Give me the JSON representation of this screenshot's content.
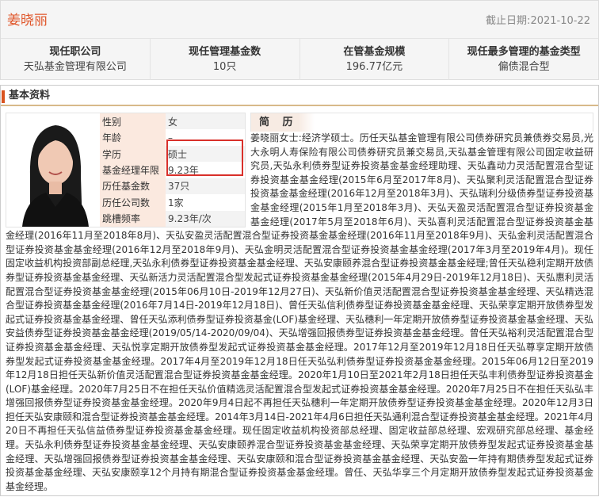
{
  "header": {
    "name": "姜晓丽",
    "date_label": "截止日期:",
    "date": "2021-10-22"
  },
  "stats": [
    {
      "label": "现任职公司",
      "value": "天弘基金管理有限公司"
    },
    {
      "label": "现任管理基金数",
      "value": "10只"
    },
    {
      "label": "在管基金规模",
      "value": "196.77亿元"
    },
    {
      "label": "现任最多管理的基金类型",
      "value": "偏债混合型"
    }
  ],
  "section": {
    "title": "基本资料"
  },
  "profile": [
    {
      "k": "性别",
      "v": "女"
    },
    {
      "k": "年龄",
      "v": "–"
    },
    {
      "k": "学历",
      "v": "硕士"
    },
    {
      "k": "基金经理年限",
      "v": "9.23年"
    },
    {
      "k": "历任基金数",
      "v": "37只"
    },
    {
      "k": "历任公司数",
      "v": "1家"
    },
    {
      "k": "跳槽频率",
      "v": "9.23年/次"
    }
  ],
  "bio": {
    "title": "简 历",
    "text": "姜晓丽女士:经济学硕士。历任天弘基金管理有限公司债券研究员兼债券交易员,光大永明人寿保险有限公司债券研究员兼交易员,天弘基金管理有限公司固定收益研究员,天弘永利债券型证券投资基金基金经理助理、天弘鑫动力灵活配置混合型证券投资基金基金经理(2015年6月至2017年8月)、天弘聚利灵活配置混合型证券投资基金基金经理(2016年12月至2018年3月)、天弘瑞利分级债券型证券投资基金基金经理(2015年1月至2018年3月)、天弘天盈灵活配置混合型证券投资基金基金经理(2017年5月至2018年6月)、天弘喜利灵活配置混合型证券投资基金基金经理(2016年11月至2018年8月)、天弘安盈灵活配置混合型证券投资基金基金经理(2016年11月至2018年9月)、天弘金利灵活配置混合型证券投资基金基金经理(2016年12月至2018年9月)、天弘金明灵活配置混合型证券投资基金基金经理(2017年3月至2019年4月)。现任固定收益机构投资部副总经理,天弘永利债券型证券投资基金基金经理、天弘安康颐养混合型证券投资基金基金经理;曾任天弘稳利定期开放债券型证券投资基金基金经理、天弘新活力灵活配置混合型发起式证券投资基金基金经理(2015年4月29日-2019年12月18日)、天弘惠利灵活配置混合型证券投资基金基金经理(2015年06月10日-2019年12月27日)、天弘新价值灵活配置混合型证券投资基金基金经理、天弘精选混合型证券投资基金基金经理(2016年7月14日-2019年12月18日)、曾任天弘信利债券型证券投资基金基金经理、天弘荣享定期开放债券型发起式证券投资基金基金经理、曾任天弘添利债券型证券投资基金(LOF)基金经理、天弘穗利一年定期开放债券型证券投资基金基金经理、天弘安益债券型证券投资基金基金经理(2019/05/14-2020/09/04)、天弘增强回报债券型证券投资基金基金经理。曾任天弘裕利灵活配置混合型证券投资基金基金经理、天弘悦享定期开放债券型发起式证券投资基金基金经理。2017年12月至2019年12月18日任天弘尊享定期开放债券型发起式证券投资基金基金经理。2017年4月至2019年12月18日任天弘弘利债券型证券投资基金基金经理。2015年06月12日至2019年12月18日担任天弘新价值灵活配置混合型证券投资基金基金经理。2020年1月10日至2021年2月18日担任天弘丰利债券型证券投资基金(LOF)基金经理。2020年7月25日不在担任天弘价值精选灵活配置混合型发起式证券投资基金基金经理。2020年7月25日不在担任天弘弘丰增强回报债券型证券投资基金基金经理。2020年9月4日起不再担任天弘穗利一年定期开放债券型证券投资基金基金经理。2020年12月3日担任天弘安康颐和混合型证券投资基金基金经理。2014年3月14日-2021年4月6日担任天弘通利混合型证券投资基金基金经理。2021年4月20日不再担任天弘信益债券型证券投资基金基金经理。现任固定收益机构投资部总经理、固定收益部总经理、宏观研究部总经理、基金经理。天弘永利债券型证券投资基金基金经理、天弘安康颐养混合型证券投资基金基金经理、天弘荣享定期开放债券型发起式证券投资基金基金经理、天弘增强回报债券型证券投资基金基金经理、天弘安康颐和混合型证券投资基金基金经理、天弘安盈一年持有期债券型发起式证券投资基金基金经理、天弘安康颐享12个月持有期混合型证券投资基金基金经理。曾任、天弘华享三个月定期开放债券型发起式证券投资基金基金经理。"
  },
  "colors": {
    "accent": "#e0562a",
    "highlight": "#d9302a",
    "label_bg": "#fbe9df"
  }
}
